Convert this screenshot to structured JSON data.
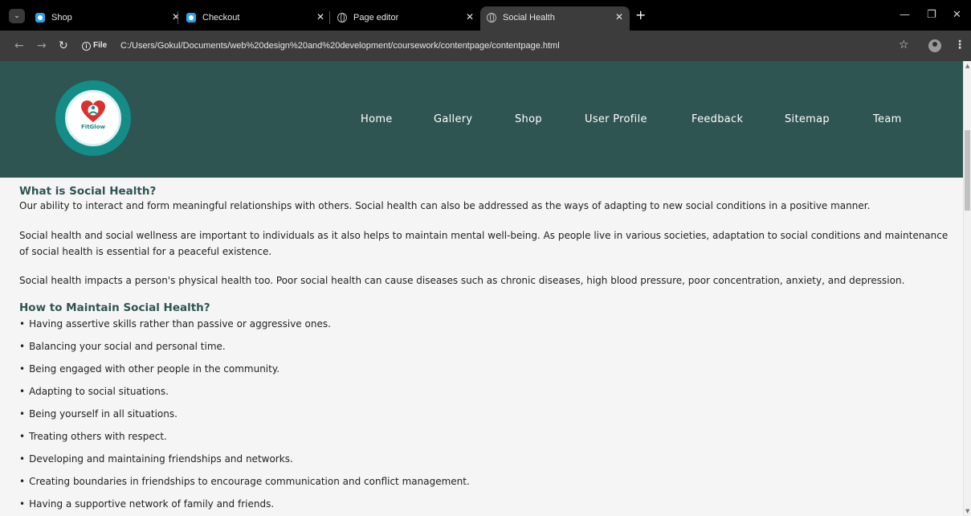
{
  "browser": {
    "tabs": [
      {
        "title": "Shop",
        "favicon": "app-icon",
        "active": false
      },
      {
        "title": "Checkout",
        "favicon": "app-icon",
        "active": false
      },
      {
        "title": "Page editor",
        "favicon": "globe-icon",
        "active": false
      },
      {
        "title": "Social Health",
        "favicon": "globe-icon",
        "active": true
      }
    ],
    "close_glyph": "✕",
    "new_tab_glyph": "+",
    "info_label": "File",
    "url": "C:/Users/Gokul/Documents/web%20design%20and%20development/coursework/contentpage/contentpage.html"
  },
  "site": {
    "logo_text": "FitGlow",
    "nav": [
      "Home",
      "Gallery",
      "Shop",
      "User Profile",
      "Feedback",
      "Sitemap",
      "Team"
    ],
    "colors": {
      "header": "#2e5552",
      "logo_ring": "#148c87",
      "heading": "#2e5552"
    }
  },
  "content": {
    "heading1": "What is Social Health?",
    "paragraphs": [
      "Our ability to interact and form meaningful relationships with others. Social health can also be addressed as the ways of adapting to new social conditions in a positive manner.",
      "Social health and social wellness are important to individuals as it also helps to maintain mental well-being. As people live in various societies, adaptation to social conditions and maintenance of social health is essential for a peaceful existence.",
      "Social health impacts a person's physical health too. Poor social health can cause diseases such as chronic diseases, high blood pressure, poor concentration, anxiety, and depression."
    ],
    "heading2": "How to Maintain Social Health?",
    "bullets": [
      "Having assertive skills rather than passive or aggressive ones.",
      "Balancing your social and personal time.",
      "Being engaged with other people in the community.",
      "Adapting to social situations.",
      "Being yourself in all situations.",
      "Treating others with respect.",
      "Developing and maintaining friendships and networks.",
      "Creating boundaries in friendships to encourage communication and conflict management.",
      "Having a supportive network of family and friends."
    ]
  }
}
